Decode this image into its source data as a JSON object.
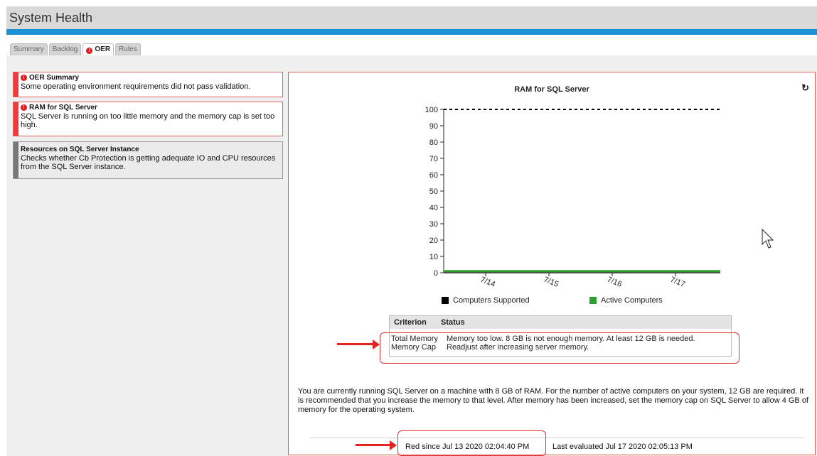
{
  "header": {
    "title": "System Health"
  },
  "tabs": [
    {
      "label": "Summary"
    },
    {
      "label": "Backlog"
    },
    {
      "label": "OER",
      "icon": "alert-icon"
    },
    {
      "label": "Rules"
    }
  ],
  "cards": [
    {
      "title": "OER Summary",
      "description": "Some operating environment requirements did not pass validation.",
      "status": "red",
      "icon": "alert-icon"
    },
    {
      "title": "RAM for SQL Server",
      "description": "SQL Server is running on too little memory and the memory cap is set too high.",
      "status": "red",
      "icon": "alert-icon"
    },
    {
      "title": "Resources on SQL Server Instance",
      "description": "Checks whether Cb Protection is getting adequate IO and CPU resources from the SQL Server instance.",
      "status": "gray"
    }
  ],
  "detail": {
    "refresh_icon": "refresh-icon",
    "criteria_table": {
      "headers": [
        "Criterion",
        "Status"
      ],
      "rows": [
        [
          "Total Memory",
          "Memory too low. 8 GB is not enough memory. At least 12 GB is needed."
        ],
        [
          "Memory Cap",
          "Readjust after increasing server memory."
        ]
      ]
    },
    "info_text": "You are currently running SQL Server on a machine with 8 GB of RAM. For the number of active computers on your system, 12 GB are required. It is recommended that you increase the memory to that level. After memory has been increased, set the memory cap on SQL Server to allow 4 GB of memory for the operating system.",
    "red_since": "Red since Jul 13 2020 02:04:40 PM",
    "last_evaluated": "Last evaluated Jul 17 2020 02:05:13 PM"
  },
  "chart_data": {
    "type": "line",
    "title": "RAM for SQL Server",
    "x": [
      "7/14",
      "7/15",
      "7/16",
      "7/17"
    ],
    "ylim": [
      0,
      100
    ],
    "yticks": [
      0,
      10,
      20,
      30,
      40,
      50,
      60,
      70,
      80,
      90,
      100
    ],
    "series": [
      {
        "name": "Computers Supported",
        "color": "#000000",
        "style": "dashed",
        "values": [
          100,
          100,
          100,
          100
        ]
      },
      {
        "name": "Active Computers",
        "color": "#2ca02c",
        "style": "solid",
        "values": [
          1,
          1,
          1,
          1
        ]
      }
    ],
    "legend": "bottom",
    "grid": false
  }
}
